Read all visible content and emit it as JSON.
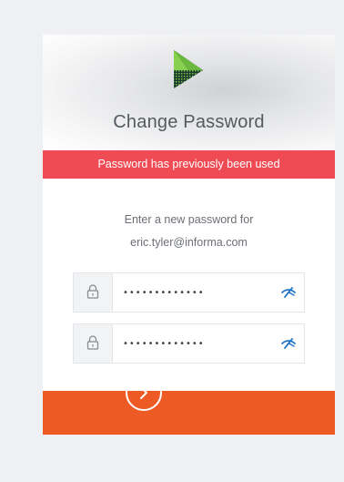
{
  "header": {
    "title": "Change Password"
  },
  "error": {
    "message": "Password has previously been used"
  },
  "prompt": {
    "line1": "Enter a new password for",
    "line2": "eric.tyler@informa.com"
  },
  "fields": [
    {
      "name": "new-password",
      "value": "•••••••••••••",
      "icon": "lock-icon",
      "toggle_icon": "eye-closed-icon"
    },
    {
      "name": "confirm-password",
      "value": "•••••••••••••",
      "icon": "lock-icon",
      "toggle_icon": "eye-closed-icon"
    }
  ],
  "colors": {
    "background": "#eef0f3",
    "error_bar": "#ef4b54",
    "footer": "#ee5a24",
    "eye_icon": "#1a72c9",
    "title": "#555a60"
  },
  "submit": {
    "icon": "chevron-right-icon"
  }
}
